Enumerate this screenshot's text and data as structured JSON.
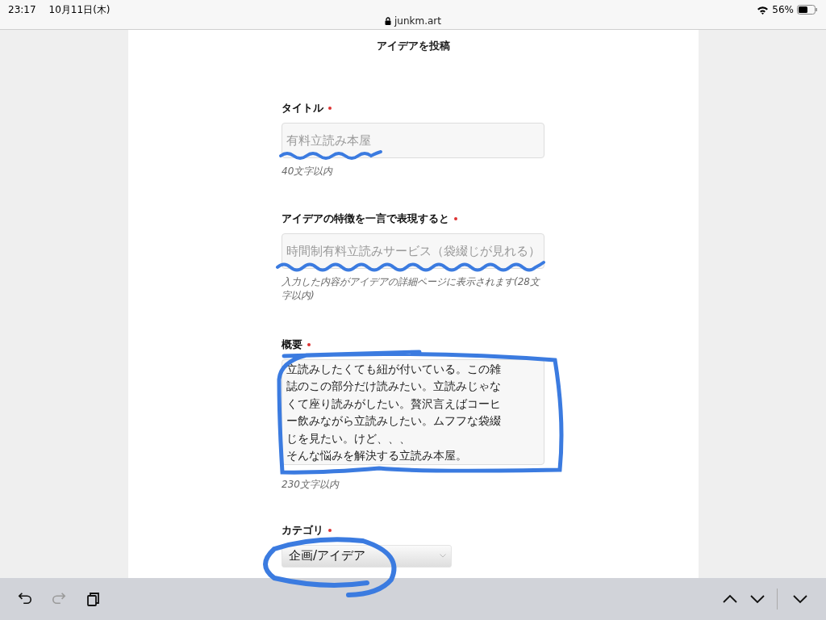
{
  "status_bar": {
    "time": "23:17",
    "date": "10月11日(木)",
    "battery": "56%"
  },
  "address_bar": {
    "url": "junkm.art"
  },
  "page": {
    "heading": "アイデアを投稿",
    "fields": [
      {
        "kind": "text",
        "label": "タイトル",
        "required": true,
        "placeholder": "有料立読み本屋",
        "hint": "40文字以内"
      },
      {
        "kind": "text",
        "label": "アイデアの特徴を一言で表現すると",
        "required": true,
        "placeholder": "時間制有料立読みサービス（袋綴じが見れる）",
        "hint": "入力した内容がアイデアの詳細ページに表示されます(28文字以内)"
      },
      {
        "kind": "textarea",
        "label": "概要",
        "required": true,
        "paragraphs": [
          "立読みしたくても紐が付いている。この雑誌のこの部分だけ読みたい。立読みじゃなくて座り読みがしたい。贅沢言えばコーヒー飲みながら立読みしたい。ムフフな袋綴じを見たい。けど、、、",
          "そんな悩みを解決する立読み本屋。"
        ],
        "hint": "230文字以内"
      },
      {
        "kind": "select",
        "label": "カテゴリ",
        "required": true,
        "value": "企画/アイデア"
      }
    ]
  },
  "toolbar": {
    "left": [
      {
        "kind": "undo",
        "disabled": false
      },
      {
        "kind": "redo",
        "disabled": true
      },
      {
        "kind": "copy",
        "disabled": false
      }
    ],
    "right": [
      {
        "kind": "up"
      },
      {
        "kind": "down"
      },
      {
        "kind": "hide"
      }
    ]
  }
}
